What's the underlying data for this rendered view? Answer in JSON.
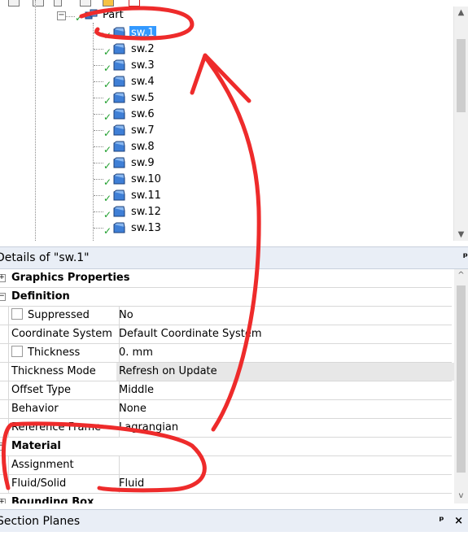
{
  "tree": {
    "parent_label": "Part",
    "items": [
      {
        "label": "sw.1",
        "selected": true
      },
      {
        "label": "sw.2"
      },
      {
        "label": "sw.3"
      },
      {
        "label": "sw.4"
      },
      {
        "label": "sw.5"
      },
      {
        "label": "sw.6"
      },
      {
        "label": "sw.7"
      },
      {
        "label": "sw.8"
      },
      {
        "label": "sw.9"
      },
      {
        "label": "sw.10"
      },
      {
        "label": "sw.11"
      },
      {
        "label": "sw.12"
      },
      {
        "label": "sw.13"
      }
    ]
  },
  "details": {
    "title": "Details of \"sw.1\"",
    "pin": "ᵖ",
    "groups": {
      "graphics": "Graphics Properties",
      "definition": "Definition",
      "material": "Material",
      "bounding_box": "Bounding Box"
    },
    "rows": {
      "suppressed": {
        "label": "Suppressed",
        "value": "No"
      },
      "coordinate_system": {
        "label": "Coordinate System",
        "value": "Default Coordinate System"
      },
      "thickness": {
        "label": "Thickness",
        "value": "0. mm"
      },
      "thickness_mode": {
        "label": "Thickness Mode",
        "value": "Refresh on Update"
      },
      "offset_type": {
        "label": "Offset Type",
        "value": "Middle"
      },
      "behavior": {
        "label": "Behavior",
        "value": "None"
      },
      "reference_frame": {
        "label": "Reference Frame",
        "value": "Lagrangian"
      },
      "assignment": {
        "label": "Assignment",
        "value": ""
      },
      "fluid_solid": {
        "label": "Fluid/Solid",
        "value": "Fluid"
      }
    }
  },
  "section_planes": {
    "title": "Section Planes",
    "buttons": "ᵖ ×"
  },
  "colors": {
    "selection": "#3399ff",
    "annotation": "#ee2b2b",
    "header_bg": "#e9eef6",
    "check_green": "#1e9e2c",
    "shaded_value": "#e7e7e7"
  },
  "icons": {
    "expander": "minus-box-icon",
    "status": "green-check-icon",
    "body": "surface-body-icon",
    "part": "part-cubes-icon"
  }
}
